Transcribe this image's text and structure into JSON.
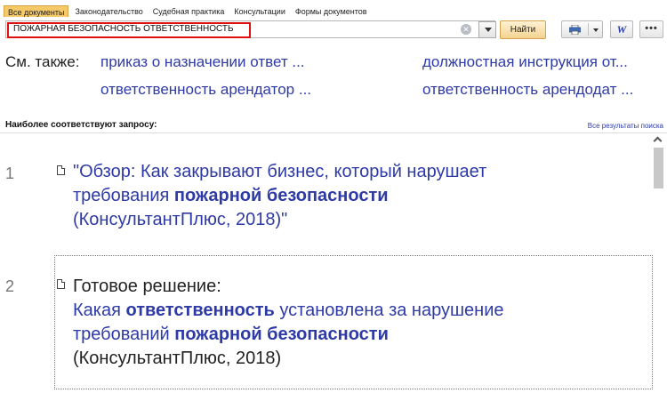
{
  "tabs": [
    {
      "label": "Все документы",
      "active": true
    },
    {
      "label": "Законодательство",
      "active": false
    },
    {
      "label": "Судебная практика",
      "active": false
    },
    {
      "label": "Консультации",
      "active": false
    },
    {
      "label": "Формы документов",
      "active": false
    }
  ],
  "search": {
    "query": "ПОЖАРНАЯ БЕЗОПАСНОСТЬ ОТВЕТСТВЕННОСТЬ",
    "find_label": "Найти"
  },
  "toolbar": {
    "word_label": "W",
    "more_label": "•••"
  },
  "see_also": {
    "label": "См. также:",
    "links": [
      "приказ о назначении ответ ...",
      "должностная инструкция от...",
      "ответственность арендатор ...",
      "ответственность арендодат ..."
    ]
  },
  "results_header": {
    "title": "Наиболее соответствуют запросу:",
    "all_results": "Все результаты поиска"
  },
  "results": [
    {
      "number": "1",
      "line1": "\"Обзор: Как закрывают бизнес, который нарушает",
      "line2_prefix": "требования ",
      "line2_bold": "пожарной безопасности",
      "line3": "(КонсультантПлюс, 2018)\""
    },
    {
      "number": "2",
      "line1": "Готовое решение:",
      "line2_prefix": "Какая ",
      "line2_bold": "ответственность",
      "line2_suffix": " установлена за нарушение",
      "line3_prefix": "требований ",
      "line3_bold": "пожарной безопасности",
      "line4": "(КонсультантПлюс, 2018)"
    }
  ],
  "colors": {
    "link": "#2e3aa6",
    "active_tab": "#f5c96a",
    "find_button": "#f3d28f",
    "highlight_border": "#e01010"
  }
}
